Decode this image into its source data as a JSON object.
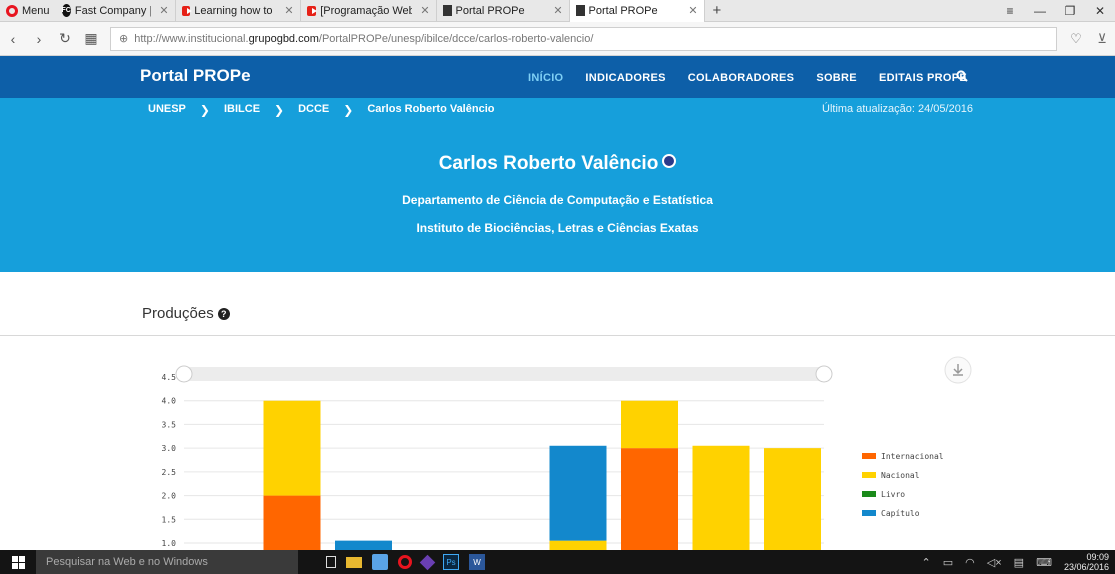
{
  "browser": {
    "menu_label": "Menu",
    "tabs": [
      {
        "title": "Fast Company | Business +",
        "icon": "fastcompany-icon"
      },
      {
        "title": "Learning how to learn | Bar",
        "icon": "youtube-icon"
      },
      {
        "title": "[Programação Web com Ja",
        "icon": "youtube-icon"
      },
      {
        "title": "Portal PROPe",
        "icon": "document-icon"
      },
      {
        "title": "Portal PROPe",
        "icon": "document-icon"
      }
    ],
    "url_prefix": "http://www.institucional.",
    "url_domain": "grupogbd.com",
    "url_path": "/PortalPROPe/unesp/ibilce/dcce/carlos-roberto-valencio/"
  },
  "site": {
    "brand": "Portal PROPe",
    "nav": [
      "INÍCIO",
      "INDICADORES",
      "COLABORADORES",
      "SOBRE",
      "EDITAIS PROPE"
    ],
    "nav_active": "INÍCIO",
    "accent_dark": "#0d5fa8",
    "accent_light": "#169fdb"
  },
  "breadcrumb": [
    "UNESP",
    "IBILCE",
    "DCCE",
    "Carlos Roberto Valêncio"
  ],
  "last_update": "Última atualização: 24/05/2016",
  "profile": {
    "name": "Carlos Roberto Valêncio",
    "department": "Departamento de Ciência de Computação e Estatística",
    "institute": "Instituto de Biociências, Letras e Ciências Exatas"
  },
  "section_title": "Produções",
  "chart_data": {
    "type": "bar",
    "stacked": true,
    "y_ticks": [
      "1.0",
      "1.5",
      "2.0",
      "2.5",
      "3.0",
      "3.5",
      "4.0",
      "4.5"
    ],
    "ylim": [
      1.0,
      4.5
    ],
    "series": [
      {
        "name": "Internacional",
        "color": "#ff6600",
        "values": [
          0,
          2,
          0.05,
          0,
          0,
          0.05,
          3,
          0.05,
          0
        ]
      },
      {
        "name": "Nacional",
        "color": "#ffd200",
        "values": [
          0.05,
          2,
          0,
          0.05,
          0.05,
          1,
          1,
          3,
          3
        ]
      },
      {
        "name": "Livro",
        "color": "#1a8a1a",
        "values": [
          0,
          0,
          0,
          0,
          0,
          0,
          0,
          0,
          0
        ]
      },
      {
        "name": "Capítulo",
        "color": "#1388cc",
        "values": [
          0,
          0,
          1,
          0,
          0,
          2,
          0,
          0,
          0
        ]
      }
    ],
    "legend_position": "right"
  },
  "taskbar": {
    "search_placeholder": "Pesquisar na Web e no Windows",
    "time": "09:09",
    "date": "23/06/2016"
  }
}
